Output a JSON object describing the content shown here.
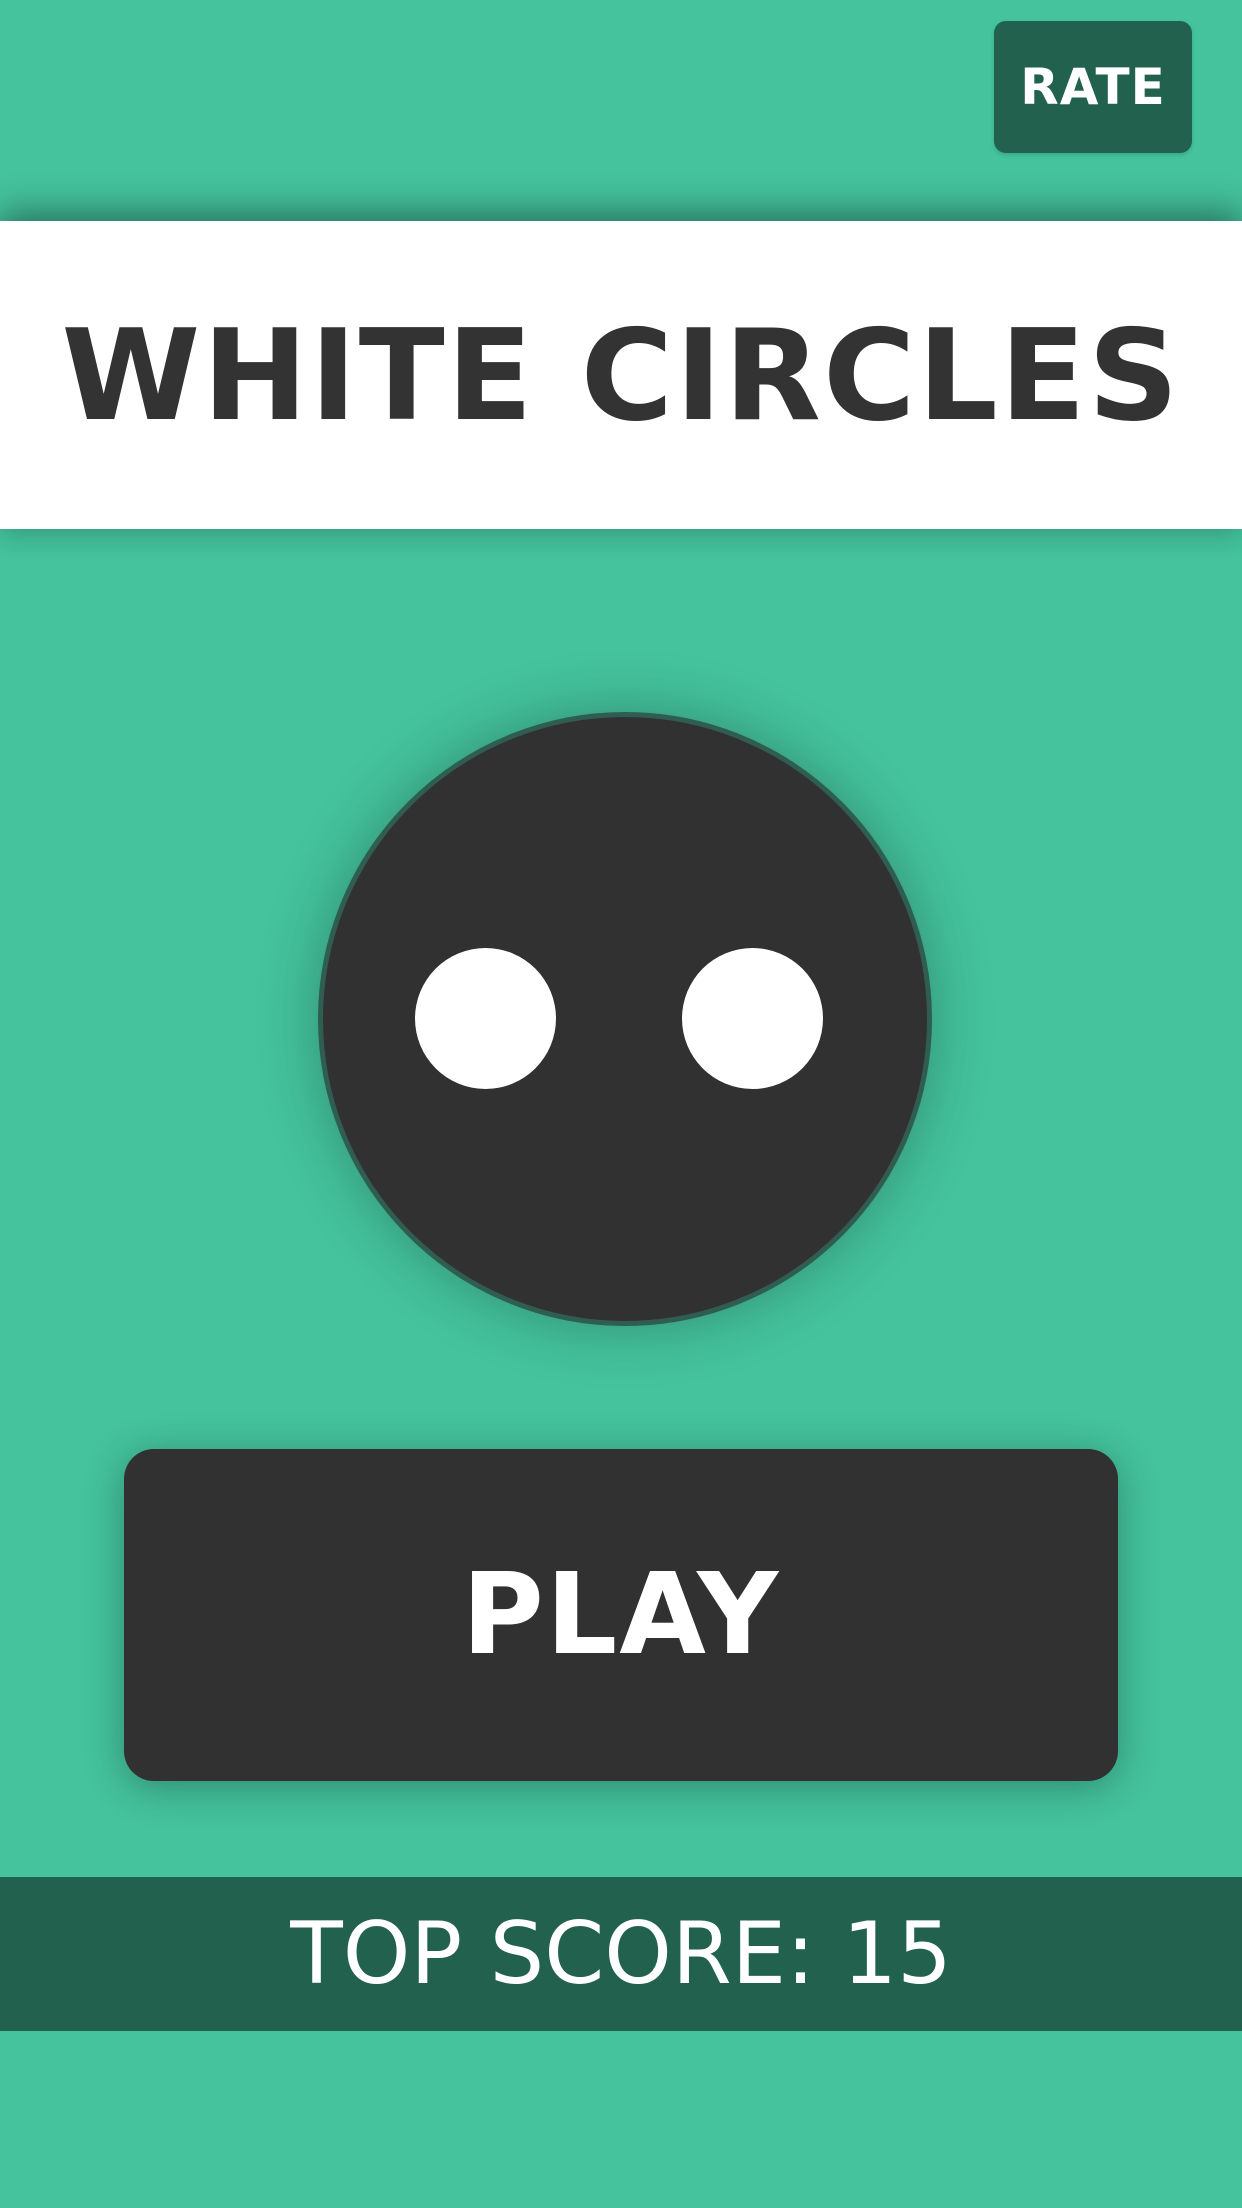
{
  "header": {
    "rate_label": "RATE"
  },
  "title": {
    "text": "WHITE CIRCLES"
  },
  "menu": {
    "play_label": "PLAY"
  },
  "score": {
    "label": "TOP SCORE: 15",
    "value": 15
  },
  "colors": {
    "background": "#44c39c",
    "dark_accent": "#22614e",
    "charcoal": "#313131",
    "white": "#ffffff"
  }
}
